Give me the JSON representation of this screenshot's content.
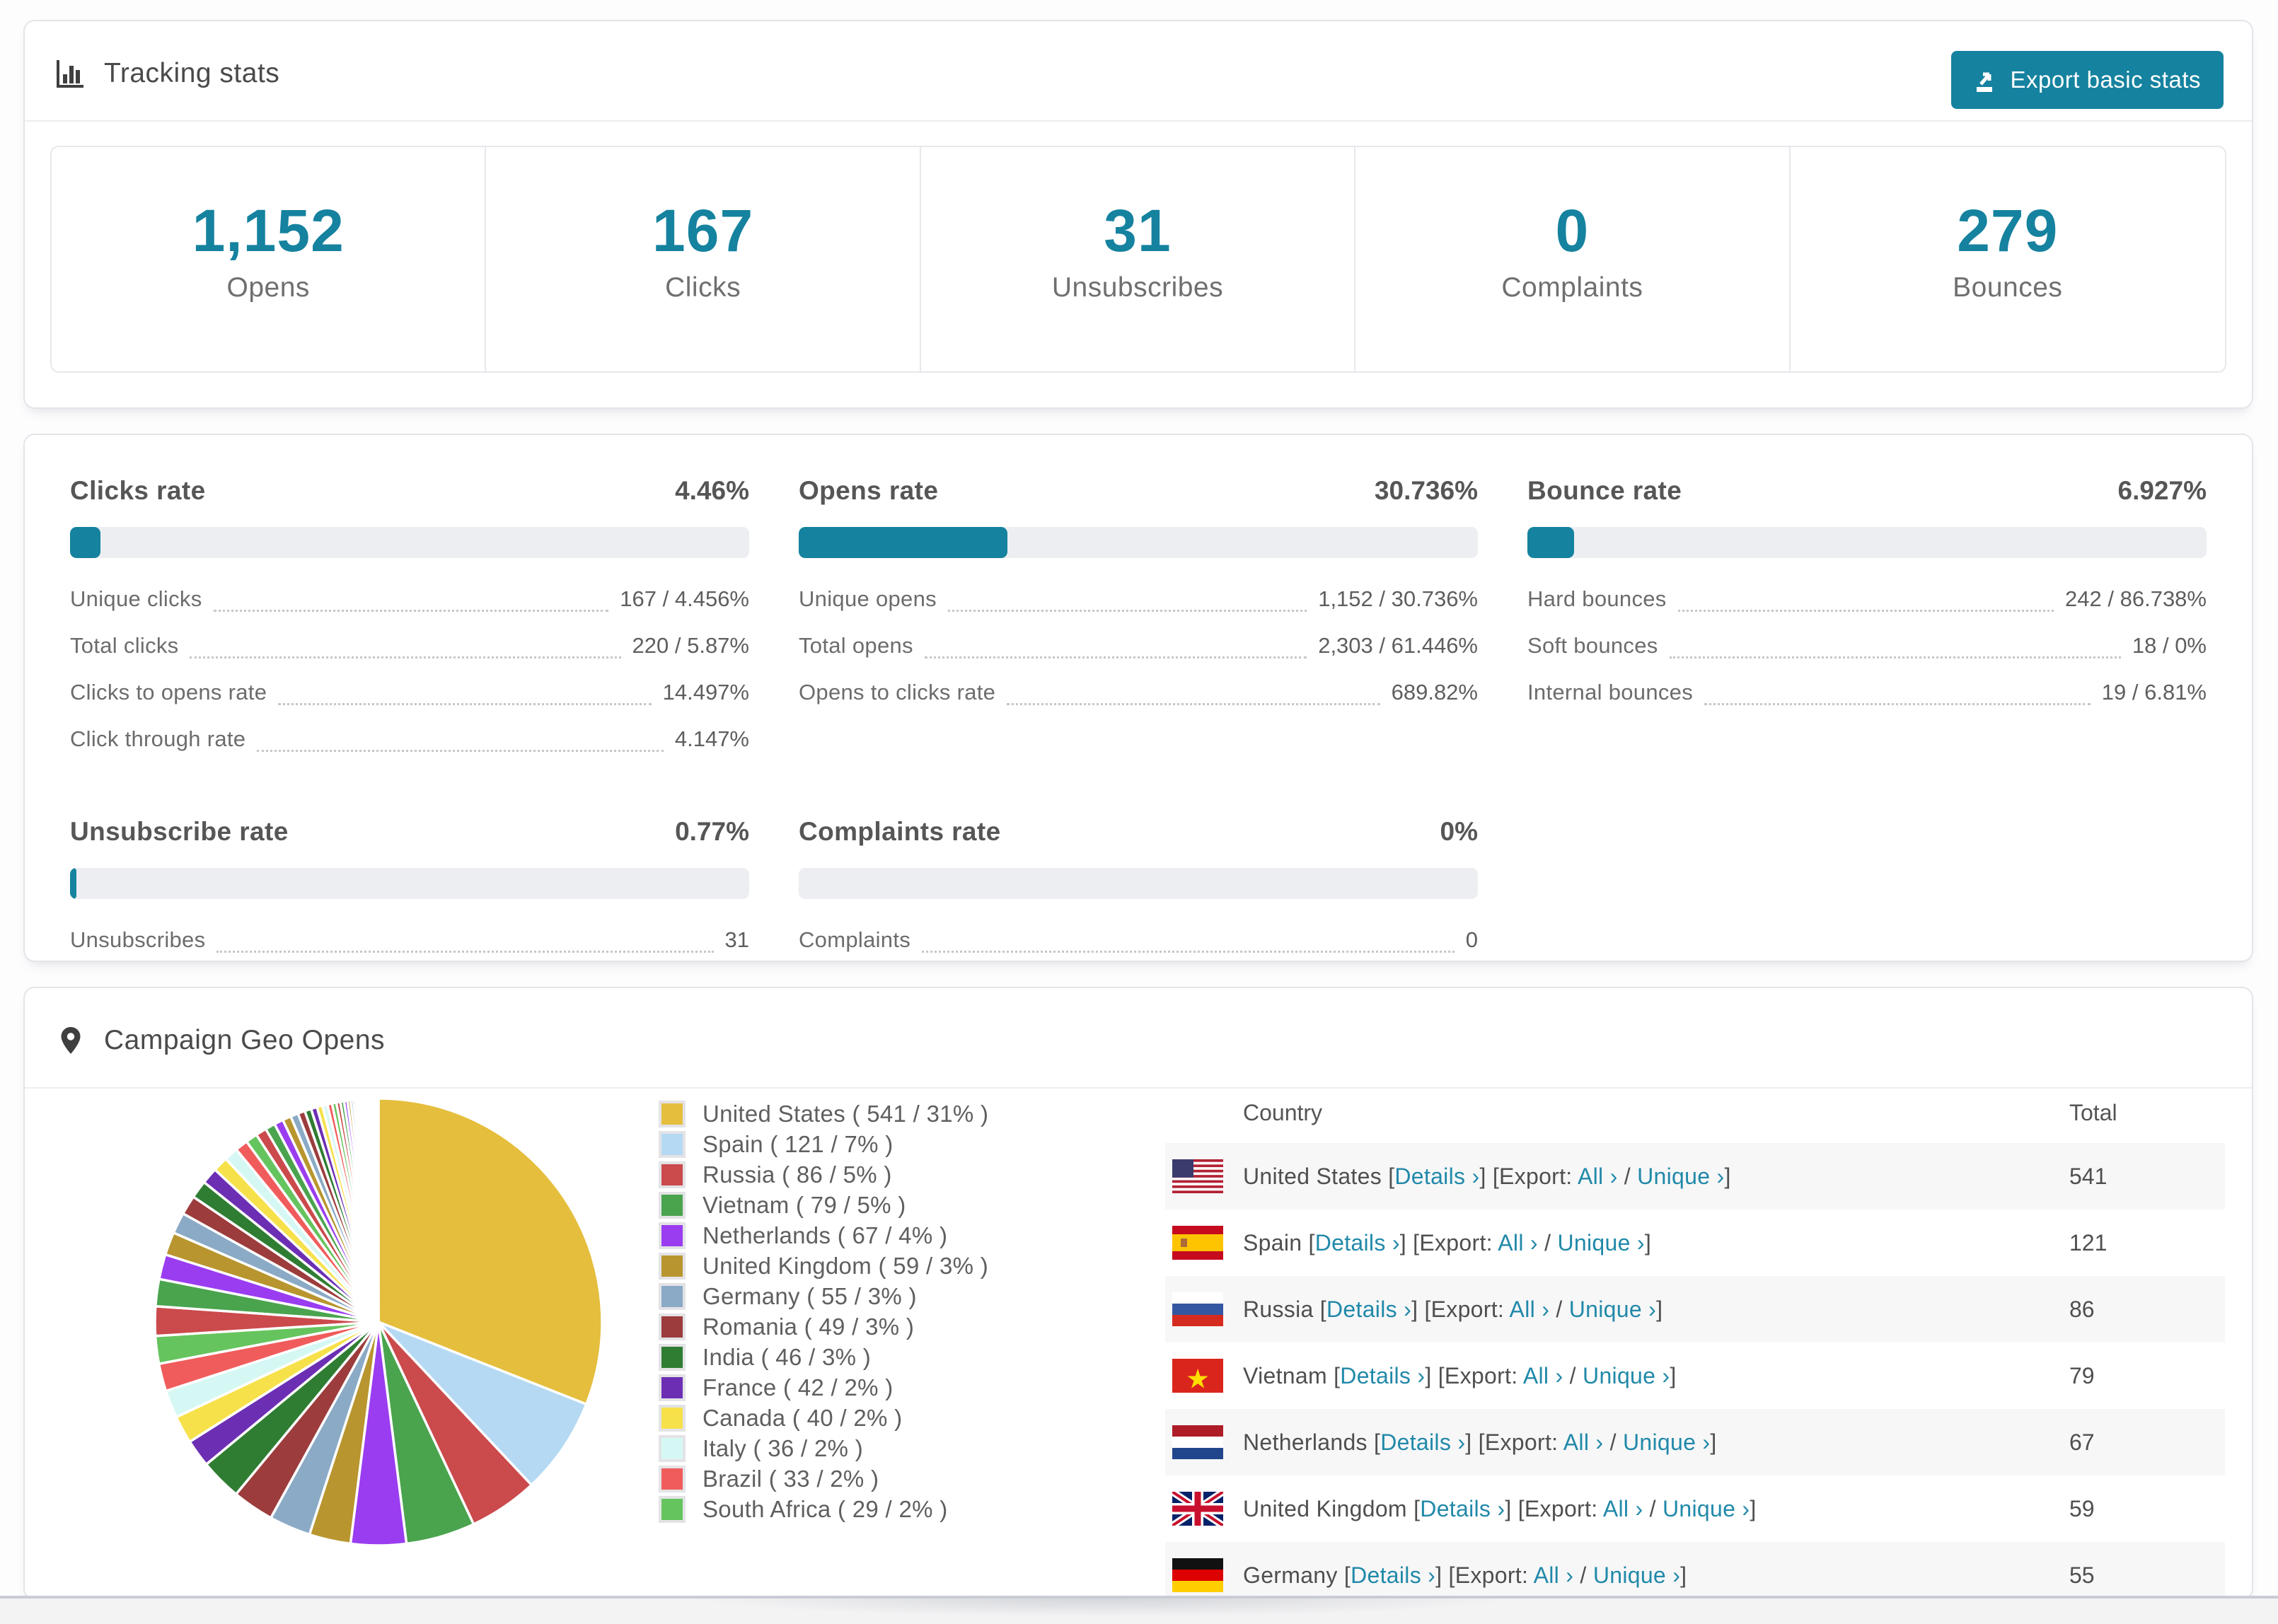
{
  "colors": {
    "accent": "#15829f",
    "link": "#2189a9"
  },
  "tracking": {
    "title": "Tracking stats",
    "export_button": "Export basic stats",
    "stats": [
      {
        "value": "1,152",
        "label": "Opens"
      },
      {
        "value": "167",
        "label": "Clicks"
      },
      {
        "value": "31",
        "label": "Unsubscribes"
      },
      {
        "value": "0",
        "label": "Complaints"
      },
      {
        "value": "279",
        "label": "Bounces"
      }
    ]
  },
  "rates": [
    {
      "title": "Clicks rate",
      "value": "4.46%",
      "percent": 4.46,
      "rows": [
        {
          "label": "Unique clicks",
          "value": "167 / 4.456%"
        },
        {
          "label": "Total clicks",
          "value": "220 / 5.87%"
        },
        {
          "label": "Clicks to opens rate",
          "value": "14.497%"
        },
        {
          "label": "Click through rate",
          "value": "4.147%"
        }
      ]
    },
    {
      "title": "Opens rate",
      "value": "30.736%",
      "percent": 30.736,
      "rows": [
        {
          "label": "Unique opens",
          "value": "1,152 / 30.736%"
        },
        {
          "label": "Total opens",
          "value": "2,303 / 61.446%"
        },
        {
          "label": "Opens to clicks rate",
          "value": "689.82%"
        }
      ]
    },
    {
      "title": "Bounce rate",
      "value": "6.927%",
      "percent": 6.927,
      "rows": [
        {
          "label": "Hard bounces",
          "value": "242 / 86.738%"
        },
        {
          "label": "Soft bounces",
          "value": "18 / 0%"
        },
        {
          "label": "Internal bounces",
          "value": "19 / 6.81%"
        }
      ]
    },
    {
      "title": "Unsubscribe rate",
      "value": "0.77%",
      "percent": 0.77,
      "rows": [
        {
          "label": "Unsubscribes",
          "value": "31"
        }
      ]
    },
    {
      "title": "Complaints rate",
      "value": "0%",
      "percent": 0,
      "rows": [
        {
          "label": "Complaints",
          "value": "0"
        }
      ]
    }
  ],
  "geo": {
    "title": "Campaign Geo Opens",
    "chart_data": {
      "type": "pie",
      "title": "Campaign Geo Opens",
      "categories": [
        "United States",
        "Spain",
        "Russia",
        "Vietnam",
        "Netherlands",
        "United Kingdom",
        "Germany",
        "Romania",
        "India",
        "France",
        "Canada",
        "Italy",
        "Brazil",
        "South Africa"
      ],
      "counts": [
        541,
        121,
        86,
        79,
        67,
        59,
        55,
        49,
        46,
        42,
        40,
        36,
        33,
        29
      ],
      "values": [
        31,
        7,
        5,
        5,
        4,
        3,
        3,
        3,
        3,
        2,
        2,
        2,
        2,
        2
      ],
      "colors": [
        "#e5be3d",
        "#b5d9f3",
        "#cb4a4c",
        "#4aa44e",
        "#9a3df0",
        "#b8952e",
        "#8aaac6",
        "#9c3c3c",
        "#2f7d33",
        "#6c2fb4",
        "#f6e14b",
        "#d6f8f4",
        "#f05c5c",
        "#66c45e"
      ],
      "others_tail": {
        "total_pct": 26,
        "count": 46,
        "decay": 0.92
      },
      "legend_position": "right",
      "start_angle": "12-oclock-clockwise"
    },
    "table": {
      "columns": {
        "country": "Country",
        "total": "Total"
      },
      "links": {
        "details": "Details ›",
        "export": "Export:",
        "all": "All ›",
        "unique": "Unique ›"
      },
      "rows": [
        {
          "country": "United States",
          "total": "541",
          "flag": "us"
        },
        {
          "country": "Spain",
          "total": "121",
          "flag": "es"
        },
        {
          "country": "Russia",
          "total": "86",
          "flag": "ru"
        },
        {
          "country": "Vietnam",
          "total": "79",
          "flag": "vn"
        },
        {
          "country": "Netherlands",
          "total": "67",
          "flag": "nl"
        },
        {
          "country": "United Kingdom",
          "total": "59",
          "flag": "gb"
        },
        {
          "country": "Germany",
          "total": "55",
          "flag": "de",
          "partial": true
        }
      ]
    }
  }
}
